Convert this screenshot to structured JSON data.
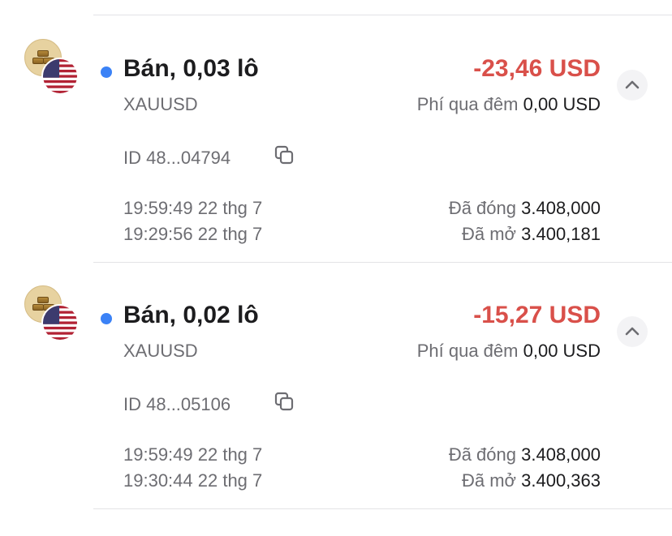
{
  "trades": [
    {
      "title": "Bán, 0,03 lô",
      "symbol": "XAUUSD",
      "pnl": "-23,46 USD",
      "fee_label": "Phí qua đêm",
      "fee_value": "0,00 USD",
      "id": "ID 48...04794",
      "close_time": "19:59:49 22 thg 7",
      "open_time": "19:29:56 22 thg 7",
      "close_label": "Đã đóng",
      "close_price": "3.408,000",
      "open_label": "Đã mở",
      "open_price": "3.400,181"
    },
    {
      "title": "Bán, 0,02 lô",
      "symbol": "XAUUSD",
      "pnl": "-15,27 USD",
      "fee_label": "Phí qua đêm",
      "fee_value": "0,00 USD",
      "id": "ID 48...05106",
      "close_time": "19:59:49 22 thg 7",
      "open_time": "19:30:44 22 thg 7",
      "close_label": "Đã đóng",
      "close_price": "3.408,000",
      "open_label": "Đã mở",
      "open_price": "3.400,363"
    }
  ],
  "colors": {
    "loss": "#d9504a",
    "status_dot": "#3b82f6",
    "muted": "#6d6d72",
    "text": "#1c1c1e"
  },
  "icons": [
    "gold-bars-icon",
    "us-flag-icon",
    "chevron-up-icon",
    "copy-icon"
  ]
}
